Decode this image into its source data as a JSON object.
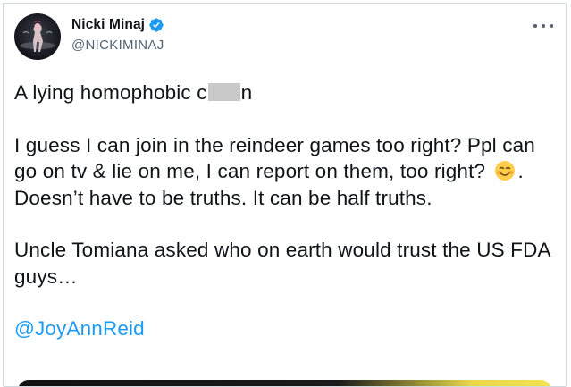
{
  "tweet": {
    "author": {
      "display_name": "Nicki Minaj",
      "handle": "@NICKIMINAJ",
      "verified": true
    },
    "text": {
      "line1_before_censor": "A lying homophobic c",
      "line1_after_censor": "n",
      "para2_before_emoji": "I guess I can join in the reindeer games too right? Ppl can go on tv & lie on me, I can report on them, too right?",
      "para2_after_emoji": ". Doesn’t have to be truths. It can be half truths.",
      "para3": "Uncle Tomiana asked who on earth would trust the US FDA guys…",
      "mention": "@JoyAnnReid"
    },
    "emoji": "smiling-face-with-blush",
    "colors": {
      "link": "#1d9bf0",
      "verified": "#1d9bf0",
      "text": "#0f1419",
      "secondary": "#536471",
      "censor_block": "#c9c9c9"
    }
  }
}
